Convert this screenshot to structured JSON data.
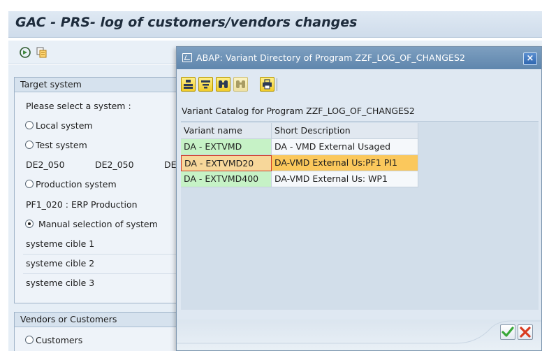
{
  "window": {
    "title": "GAC - PRS- log of customers/vendors changes"
  },
  "toolbar": {
    "icons": [
      "execute-icon",
      "variants-icon"
    ]
  },
  "target_system": {
    "header": "Target system",
    "prompt": "Please select a system :",
    "local_label": "Local system",
    "test_label": "Test system",
    "test_values": [
      "DE2_050",
      "DE2_050",
      "DE"
    ],
    "production_label": "Production system",
    "production_value": "PF1_020 : ERP Production",
    "manual_label": "Manual selection of system",
    "cibles": [
      "systeme cible 1",
      "systeme cible 2",
      "systeme cible 3"
    ]
  },
  "vendors_customers": {
    "header": "Vendors or Customers",
    "customers_label": "Customers"
  },
  "dialog": {
    "title": "ABAP: Variant Directory of Program ZZF_LOG_OF_CHANGES2",
    "close_label": "×",
    "catalog_label": "Variant Catalog for Program ZZF_LOG_OF_CHANGES2",
    "columns": [
      "Variant name",
      "Short Description"
    ],
    "rows": [
      {
        "variant": "DA - EXTVMD",
        "description": "DA - VMD External Usaged"
      },
      {
        "variant": "DA - EXTVMD20",
        "description": "DA-VMD External Us:PF1 PI1"
      },
      {
        "variant": "DA - EXTVMD400",
        "description": "DA-VMD External Us: WP1"
      }
    ],
    "selected_row": 1,
    "toolbar_icons": [
      "choose-icon",
      "filter-icon",
      "find-icon",
      "find-next-icon",
      "print-icon"
    ],
    "ok_icon": "checkmark-icon",
    "cancel_icon": "cancel-x-icon"
  },
  "colors": {
    "title_bar": "#cfdceb",
    "dialog_title": "#6a8fb5",
    "variant_cell": "#c6f2c6",
    "selected_row": "#fbc85c",
    "ok_green": "#38a838",
    "cancel_red": "#d93b20"
  }
}
